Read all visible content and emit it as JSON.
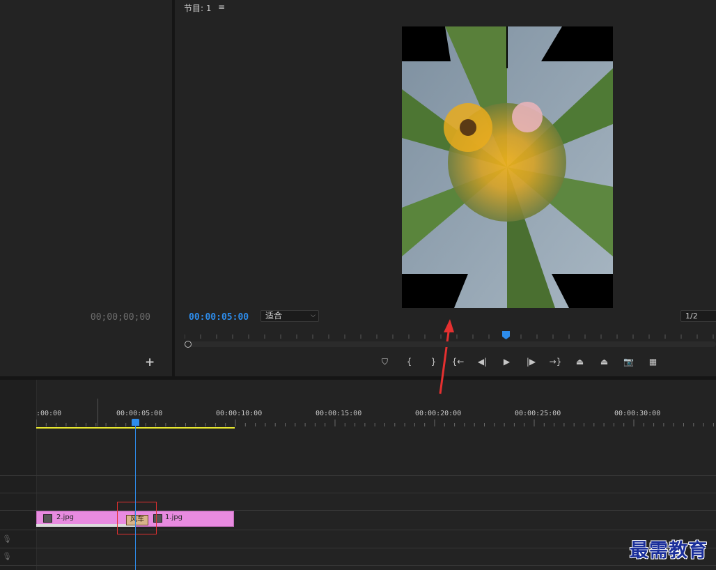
{
  "source_monitor": {
    "timecode": "00;00;00;00",
    "add_label": "+"
  },
  "program_monitor": {
    "title": "节目: 1",
    "menu_icon": "≡",
    "timecode": "00:00:05:00",
    "fit_value": "适合",
    "resolution_value": "1/2",
    "playhead_progress": 0.6
  },
  "controls": [
    {
      "name": "add-marker-button",
      "glyph": "⛉"
    },
    {
      "name": "mark-in-button",
      "glyph": "{"
    },
    {
      "name": "mark-out-button",
      "glyph": "}"
    },
    {
      "name": "go-to-in-button",
      "glyph": "{←"
    },
    {
      "name": "step-back-button",
      "glyph": "◀|"
    },
    {
      "name": "play-button",
      "glyph": "▶"
    },
    {
      "name": "step-forward-button",
      "glyph": "|▶"
    },
    {
      "name": "go-to-out-button",
      "glyph": "→}"
    },
    {
      "name": "lift-button",
      "glyph": "⏏"
    },
    {
      "name": "extract-button",
      "glyph": "⏏"
    },
    {
      "name": "export-frame-button",
      "glyph": "📷"
    },
    {
      "name": "compare-view-button",
      "glyph": "▦"
    }
  ],
  "timeline": {
    "timestamps": [
      ":00:00",
      "00:00:05:00",
      "00:00:10:00",
      "00:00:15:00",
      "00:00:20:00",
      "00:00:25:00",
      "00:00:30:00"
    ],
    "clips": [
      {
        "name": "2.jpg"
      },
      {
        "name": "1.jpg"
      }
    ],
    "transition_label": "风车"
  },
  "watermark": "最需教育",
  "colors": {
    "accent": "#2d8ceb",
    "clip": "#e88be0",
    "annotation": "#e53030"
  }
}
